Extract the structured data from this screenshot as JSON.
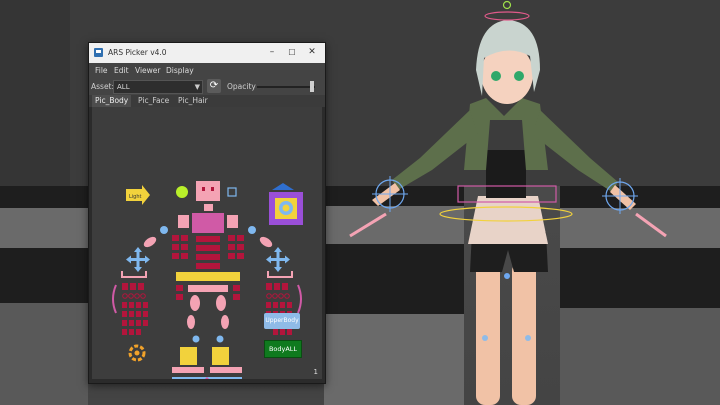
{
  "window": {
    "title": "ARS Picker v4.0",
    "minimize_glyph": "–",
    "maximize_glyph": "☐",
    "close_glyph": "✕"
  },
  "menu": {
    "items": [
      "File",
      "Edit",
      "Viewer",
      "Display"
    ]
  },
  "asset": {
    "label": "Asset:",
    "value": "ALL",
    "dropdown_glyph": "▼",
    "refresh_glyph": "⟳"
  },
  "opacity": {
    "label": "Opacity",
    "level": 0.95
  },
  "tabs": [
    {
      "label": "Pic_Body",
      "active": true
    },
    {
      "label": "Pic_Face",
      "active": false
    },
    {
      "label": "Pic_Hair",
      "active": false
    }
  ],
  "picker": {
    "light_label": "Light",
    "upperbody_label": "UpperBody",
    "bodyall_label": "BodyALL",
    "page_number": "1",
    "colors": {
      "pink": "#f4a3b4",
      "crimson": "#b3153c",
      "magenta": "#d05aa6",
      "yellow": "#f2d23c",
      "lightblue": "#7fb8ef",
      "purple": "#9a4fd8",
      "lime": "#b9f02a",
      "orange": "#f1a22a",
      "green": "#0f7a1e"
    }
  }
}
